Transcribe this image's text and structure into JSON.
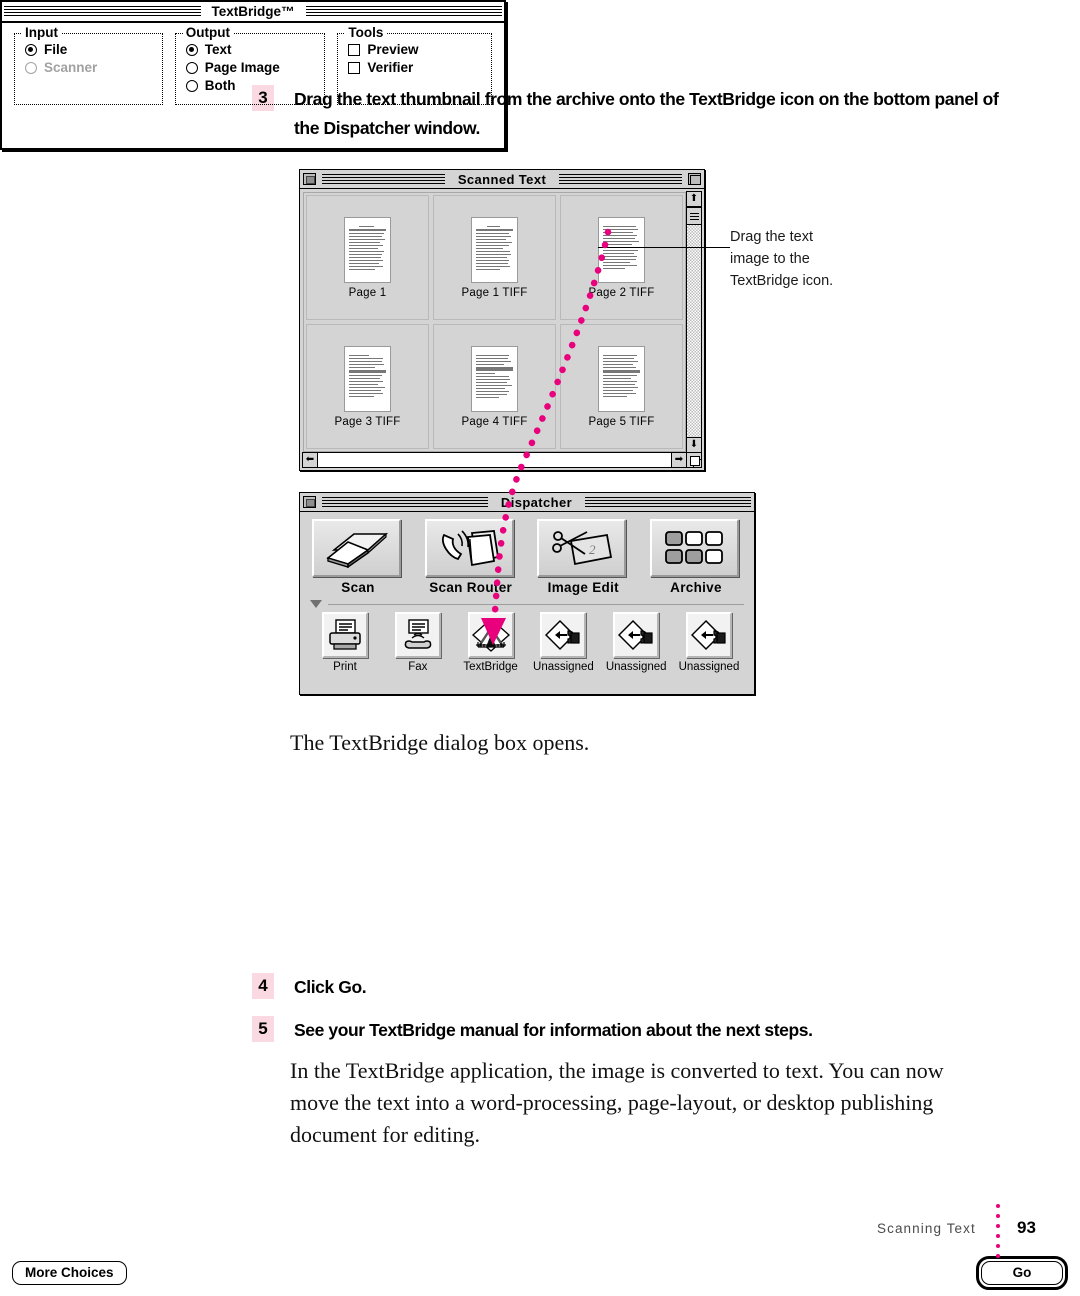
{
  "steps": [
    {
      "num": "3",
      "text": "Drag the text thumbnail from the archive onto the TextBridge icon on the bottom panel of the Dispatcher window."
    },
    {
      "num": "4",
      "text": "Click Go."
    },
    {
      "num": "5",
      "text": "See your TextBridge manual for information about the next steps."
    }
  ],
  "paragraphs": {
    "dialog_opens": "The TextBridge dialog box opens.",
    "closing": "In the TextBridge application, the image is converted to text. You can now move the text into a word-processing, page-layout, or desktop publishing document for editing."
  },
  "callout": {
    "line1": "Drag the text",
    "line2": "image to the",
    "line3": "TextBridge icon."
  },
  "scanned_text_window": {
    "title": "Scanned Text",
    "thumbnails": [
      {
        "label": "Page 1"
      },
      {
        "label": "Page 1 TIFF"
      },
      {
        "label": "Page 2 TIFF"
      },
      {
        "label": "Page 3 TIFF"
      },
      {
        "label": "Page 4 TIFF"
      },
      {
        "label": "Page 5 TIFF"
      }
    ]
  },
  "dispatcher_window": {
    "title": "Dispatcher",
    "top_panel": [
      {
        "label": "Scan",
        "icon": "scanner-icon"
      },
      {
        "label": "Scan Router",
        "icon": "fax-book-icon"
      },
      {
        "label": "Image Edit",
        "icon": "scissors-photo-icon"
      },
      {
        "label": "Archive",
        "icon": "grid-tiles-icon"
      }
    ],
    "bottom_panel": [
      {
        "label": "Print",
        "icon": "printer-icon"
      },
      {
        "label": "Fax",
        "icon": "fax-machine-icon"
      },
      {
        "label": "TextBridge",
        "icon": "textbridge-icon"
      },
      {
        "label": "Unassigned",
        "icon": "unassigned-diamond-icon"
      },
      {
        "label": "Unassigned",
        "icon": "unassigned-diamond-icon"
      },
      {
        "label": "Unassigned",
        "icon": "unassigned-diamond-icon"
      }
    ]
  },
  "textbridge_dialog": {
    "title": "TextBridge™",
    "input": {
      "legend": "Input",
      "options": [
        {
          "label": "File",
          "selected": true,
          "disabled": false
        },
        {
          "label": "Scanner",
          "selected": false,
          "disabled": true
        }
      ]
    },
    "output": {
      "legend": "Output",
      "options": [
        {
          "label": "Text",
          "selected": true
        },
        {
          "label": "Page Image",
          "selected": false
        },
        {
          "label": "Both",
          "selected": false
        }
      ]
    },
    "tools": {
      "legend": "Tools",
      "options": [
        {
          "label": "Preview",
          "checked": false
        },
        {
          "label": "Verifier",
          "checked": false
        }
      ]
    },
    "more_choices_label": "More Choices",
    "go_label": "Go"
  },
  "footer": {
    "section": "Scanning Text",
    "page": "93"
  },
  "colors": {
    "step_badge_bg": "#fbd9e3",
    "accent_magenta": "#e8007d",
    "window_gray": "#d4d4d4"
  }
}
